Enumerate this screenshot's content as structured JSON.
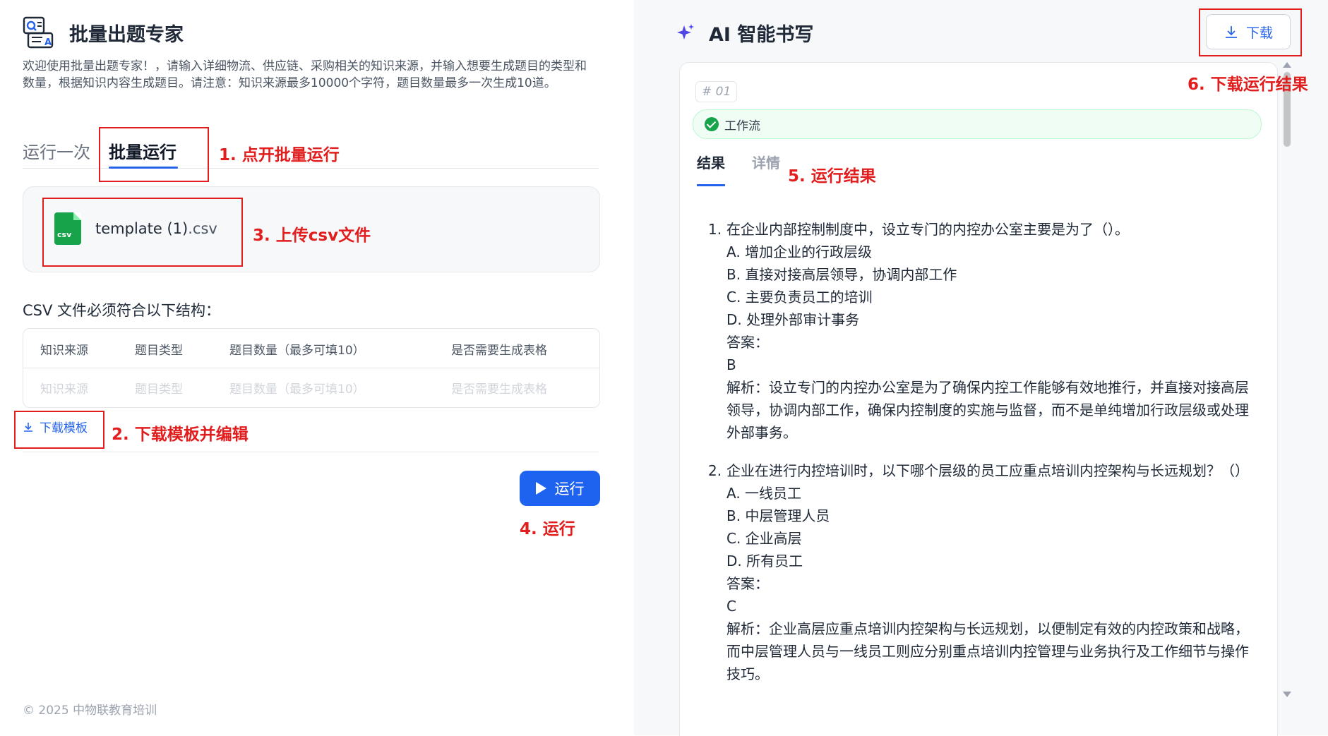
{
  "app": {
    "title": "批量出题专家",
    "intro": "欢迎使用批量出题专家！，请输入详细物流、供应链、采购相关的知识来源，并输入想要生成题目的类型和数量，根据知识内容生成题目。请注意：知识来源最多10000个字符，题目数量最多一次生成10道。"
  },
  "tabs": {
    "once": "运行一次",
    "batch": "批量运行"
  },
  "upload": {
    "file_base": "template (1)",
    "file_ext": ".csv",
    "icon_text": "csv"
  },
  "csv": {
    "title": "CSV 文件必须符合以下结构：",
    "headers": [
      "知识来源",
      "题目类型",
      "题目数量（最多可填10）",
      "是否需要生成表格"
    ],
    "placeholders": [
      "知识来源",
      "题目类型",
      "题目数量（最多可填10）",
      "是否需要生成表格"
    ]
  },
  "download_template": "下载模板",
  "run_button": "运行",
  "footer": "© 2025 中物联教育培训",
  "annotations": {
    "a1": "1. 点开批量运行",
    "a2": "2. 下载模板并编辑",
    "a3": "3. 上传csv文件",
    "a4": "4. 运行",
    "a5": "5. 运行结果",
    "a6": "6. 下载运行结果"
  },
  "ai": {
    "title": "AI 智能书写",
    "download_button": "下载",
    "run_badge": "# 01",
    "workflow_label": "工作流",
    "tab_result": "结果",
    "tab_detail": "详情"
  },
  "questions": [
    {
      "num": "1.",
      "stem": "在企业内部控制制度中，设立专门的内控办公室主要是为了（）。",
      "options": [
        "A. 增加企业的行政层级",
        "B. 直接对接高层领导，协调内部工作",
        "C. 主要负责员工的培训",
        "D. 处理外部审计事务"
      ],
      "answer_label": "答案：",
      "answer": "B",
      "analysis": "解析：设立专门的内控办公室是为了确保内控工作能够有效地推行，并直接对接高层领导，协调内部工作，确保内控制度的实施与监督，而不是单纯增加行政层级或处理外部事务。"
    },
    {
      "num": "2.",
      "stem": "企业在进行内控培训时，以下哪个层级的员工应重点培训内控架构与长远规划？（）",
      "options": [
        "A. 一线员工",
        "B. 中层管理人员",
        "C. 企业高层",
        "D. 所有员工"
      ],
      "answer_label": "答案：",
      "answer": "C",
      "analysis": "解析：企业高层应重点培训内控架构与长远规划，以便制定有效的内控政策和战略，而中层管理人员与一线员工则应分别重点培训内控管理与业务执行及工作细节与操作技巧。"
    }
  ],
  "colors": {
    "accent": "#2563eb",
    "annotation": "#e11d1d",
    "success": "#16a34a"
  }
}
